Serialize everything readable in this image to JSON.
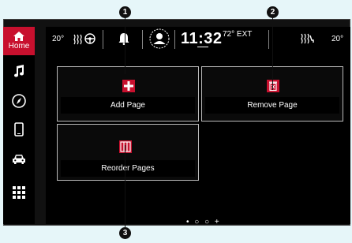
{
  "sidebar": {
    "home_label": "Home",
    "items": [
      {
        "icon": "home-icon"
      },
      {
        "icon": "music-note-icon"
      },
      {
        "icon": "compass-icon"
      },
      {
        "icon": "phone-icon"
      },
      {
        "icon": "car-icon"
      },
      {
        "icon": "apps-grid-icon"
      }
    ]
  },
  "topbar": {
    "driver_temp": "20°",
    "clock": "11:32",
    "exterior_temp": "72° EXT",
    "passenger_temp": "20°"
  },
  "tiles": {
    "add_page": "Add Page",
    "remove_page": "Remove Page",
    "reorder_pages": "Reorder Pages"
  },
  "pager": {
    "indicator": "• ○ ○ +"
  },
  "callouts": {
    "one": "1",
    "two": "2",
    "three": "3"
  },
  "colors": {
    "accent": "#c8102e",
    "background": "#000000",
    "page": "#e6f6f9"
  }
}
